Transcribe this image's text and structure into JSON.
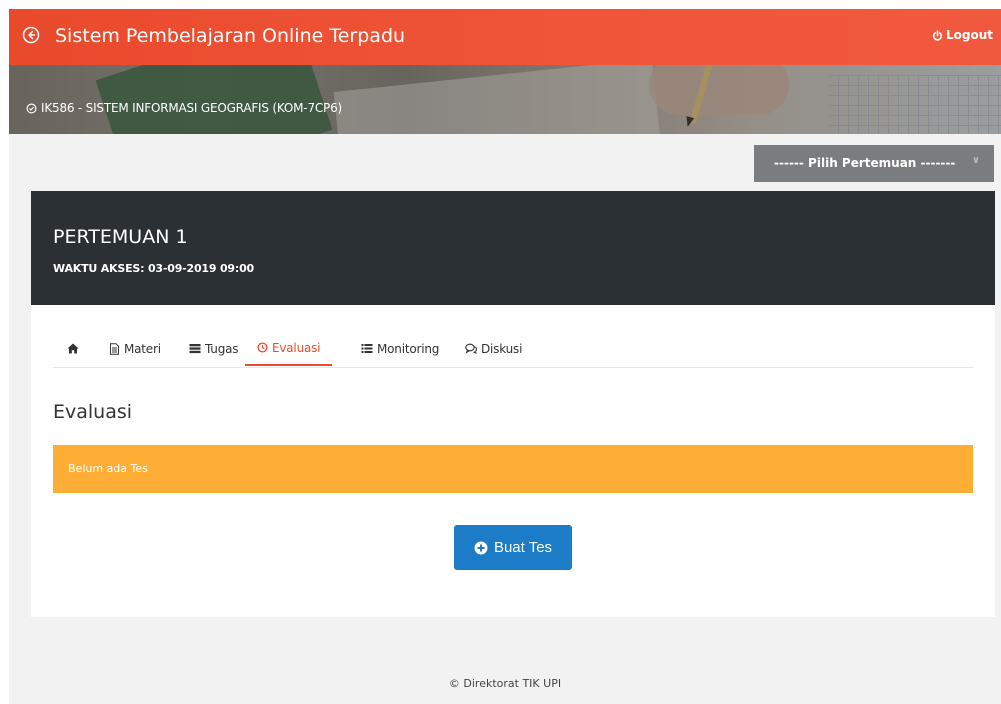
{
  "header": {
    "app_title": "Sistem Pembelajaran Online Terpadu",
    "logout_label": "Logout",
    "back_icon": "arrow-circle-left-icon",
    "power_icon": "power-icon"
  },
  "course": {
    "title": "IK586 - SISTEM INFORMASI GEOGRAFIS (KOM-7CP6)",
    "check_icon": "check-circle-icon"
  },
  "meeting_select": {
    "selected": "------ Pilih Pertemuan -------"
  },
  "meeting": {
    "title": "PERTEMUAN 1",
    "access_time": "WAKTU AKSES: 03-09-2019 09:00"
  },
  "tabs": [
    {
      "label": "",
      "icon": "home-icon"
    },
    {
      "label": "Materi",
      "icon": "file-icon"
    },
    {
      "label": "Tugas",
      "icon": "tasks-icon"
    },
    {
      "label": "Evaluasi",
      "icon": "clock-icon",
      "active": true
    },
    {
      "label": "Monitoring",
      "icon": "list-icon"
    },
    {
      "label": "Diskusi",
      "icon": "comments-icon"
    }
  ],
  "evaluation": {
    "heading": "Evaluasi",
    "empty_message": "Belum ada Tes",
    "create_button": "Buat Tes"
  },
  "footer": {
    "text": "© Direktorat TIK UPI"
  },
  "colors": {
    "header": "#f0553a",
    "accent": "#e84c2f",
    "dark_panel": "#2a3033",
    "alert": "#ffae35",
    "button": "#1c7cc7"
  }
}
